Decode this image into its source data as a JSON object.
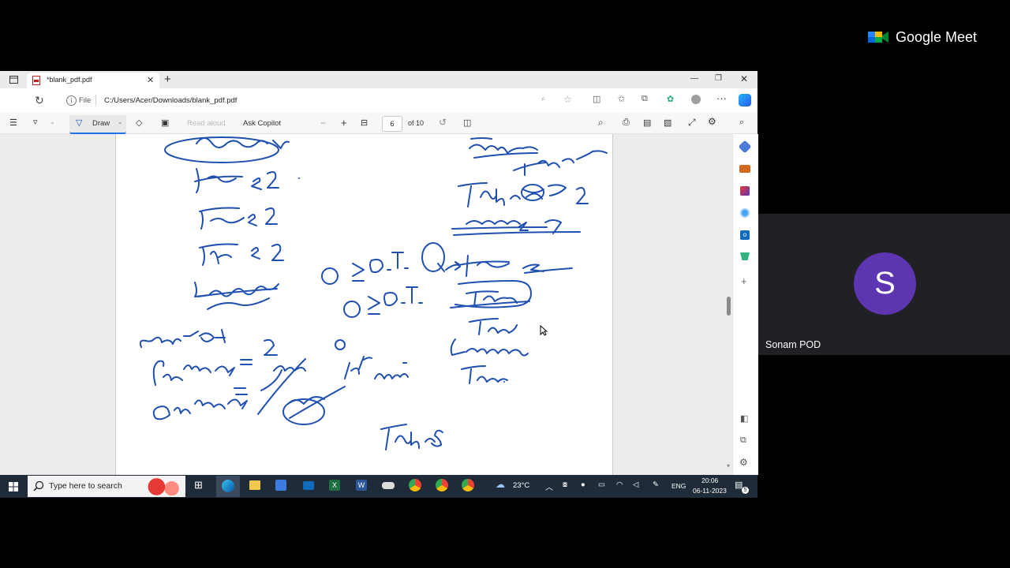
{
  "meet": {
    "brand": "Google Meet",
    "participant_name": "Sonam POD",
    "avatar_initial": "S"
  },
  "browser": {
    "tab_title": "*blank_pdf.pdf",
    "file_label": "File",
    "url": "C:/Users/Acer/Downloads/blank_pdf.pdf"
  },
  "pdf_toolbar": {
    "draw_label": "Draw",
    "readaloud_label": "Read aloud",
    "copilot_label": "Ask Copilot",
    "zoom_minus": "−",
    "zoom_plus": "+",
    "page_current": "6",
    "page_total": "of 10"
  },
  "taskbar": {
    "search_placeholder": "Type here to search",
    "weather": "23°C",
    "language": "ENG",
    "time": "20:06",
    "date": "06-11-2023",
    "notification_count": "5"
  },
  "colors": {
    "ink": "#1f4fb0",
    "meet_avatar": "#5e35b1",
    "taskbar": "#1f2b38"
  }
}
